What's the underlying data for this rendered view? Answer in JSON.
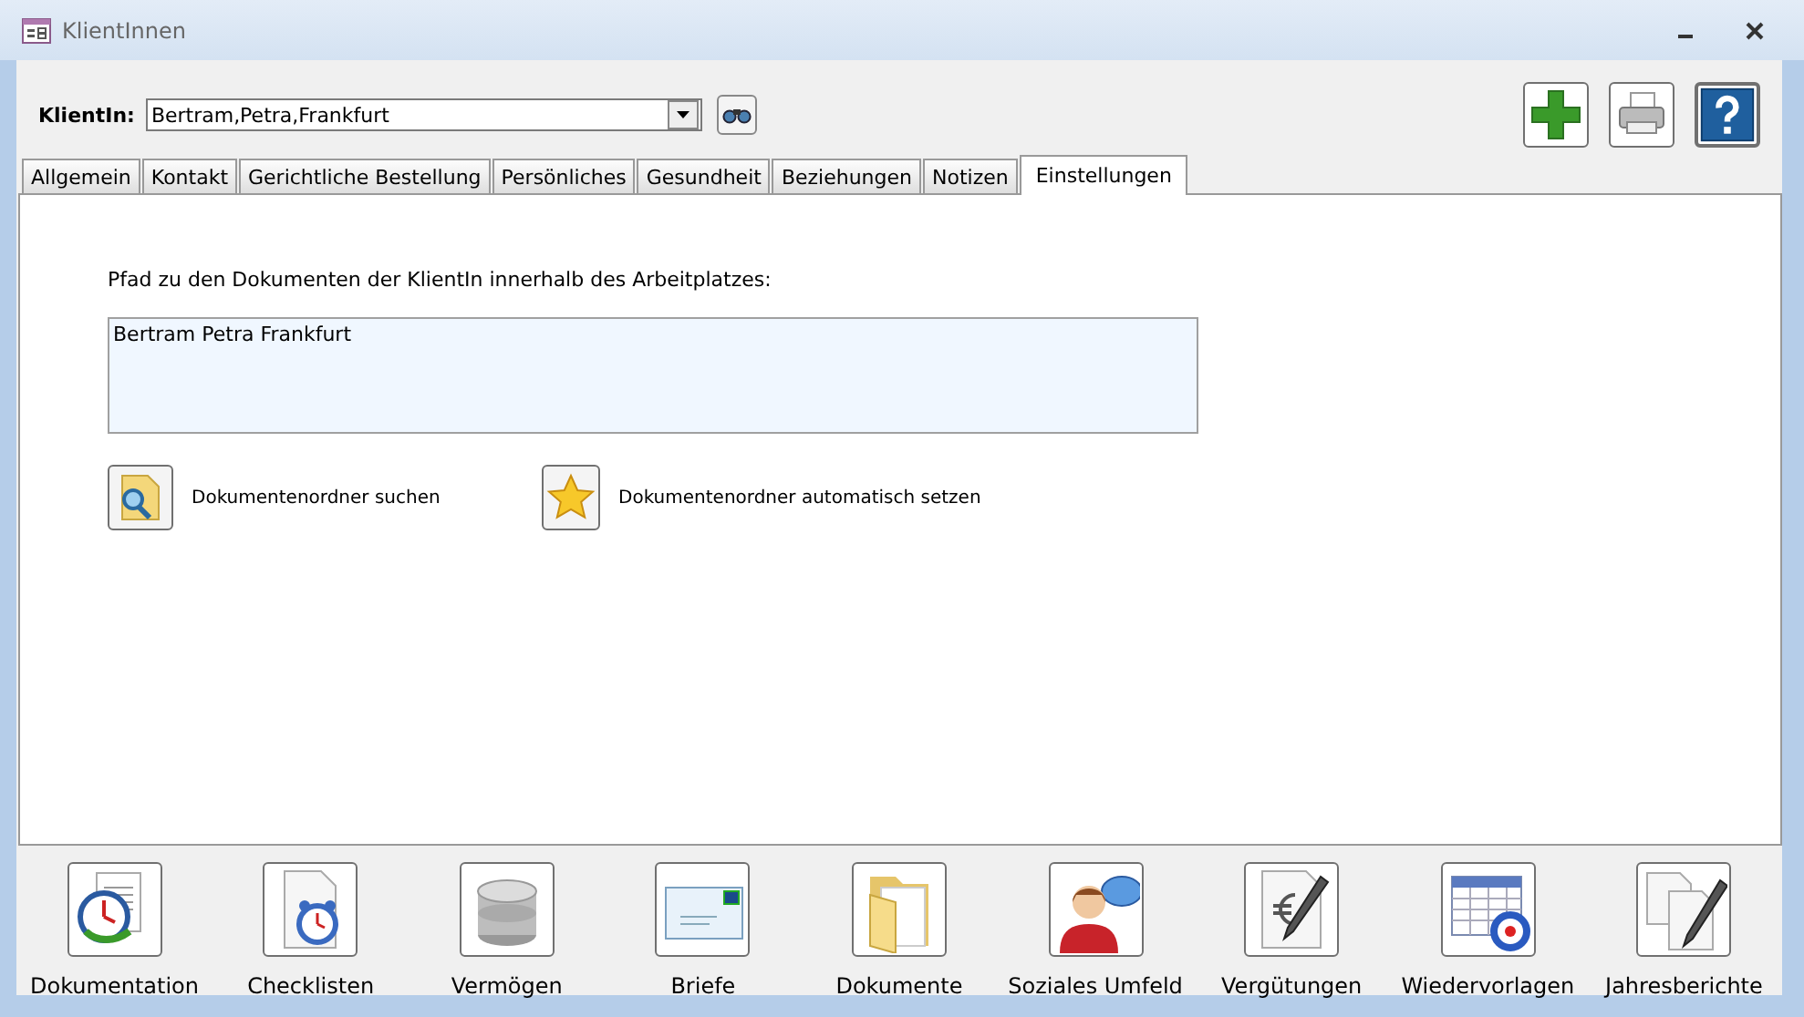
{
  "window": {
    "title": "KlientInnen"
  },
  "client_select": {
    "label": "KlientIn:",
    "value": "Bertram,Petra,Frankfurt"
  },
  "tabs": [
    {
      "label": "Allgemein",
      "selected": false
    },
    {
      "label": "Kontakt",
      "selected": false
    },
    {
      "label": "Gerichtliche Bestellung",
      "selected": false
    },
    {
      "label": "Persönliches",
      "selected": false
    },
    {
      "label": "Gesundheit",
      "selected": false
    },
    {
      "label": "Beziehungen",
      "selected": false
    },
    {
      "label": "Notizen",
      "selected": false
    },
    {
      "label": "Einstellungen",
      "selected": true
    }
  ],
  "settings": {
    "path_label": "Pfad zu den Dokumenten der KlientIn innerhalb des Arbeitplatzes:",
    "path_value": "Bertram Petra Frankfurt",
    "actions": [
      {
        "label": "Dokumentenordner suchen"
      },
      {
        "label": "Dokumentenordner automatisch setzen"
      }
    ]
  },
  "bottom_buttons": [
    {
      "label": "Dokumentation"
    },
    {
      "label": "Checklisten"
    },
    {
      "label": "Vermögen"
    },
    {
      "label": "Briefe"
    },
    {
      "label": "Dokumente"
    },
    {
      "label": "Soziales Umfeld"
    },
    {
      "label": "Vergütungen"
    },
    {
      "label": "Wiedervorlagen"
    },
    {
      "label": "Jahresberichte"
    }
  ]
}
